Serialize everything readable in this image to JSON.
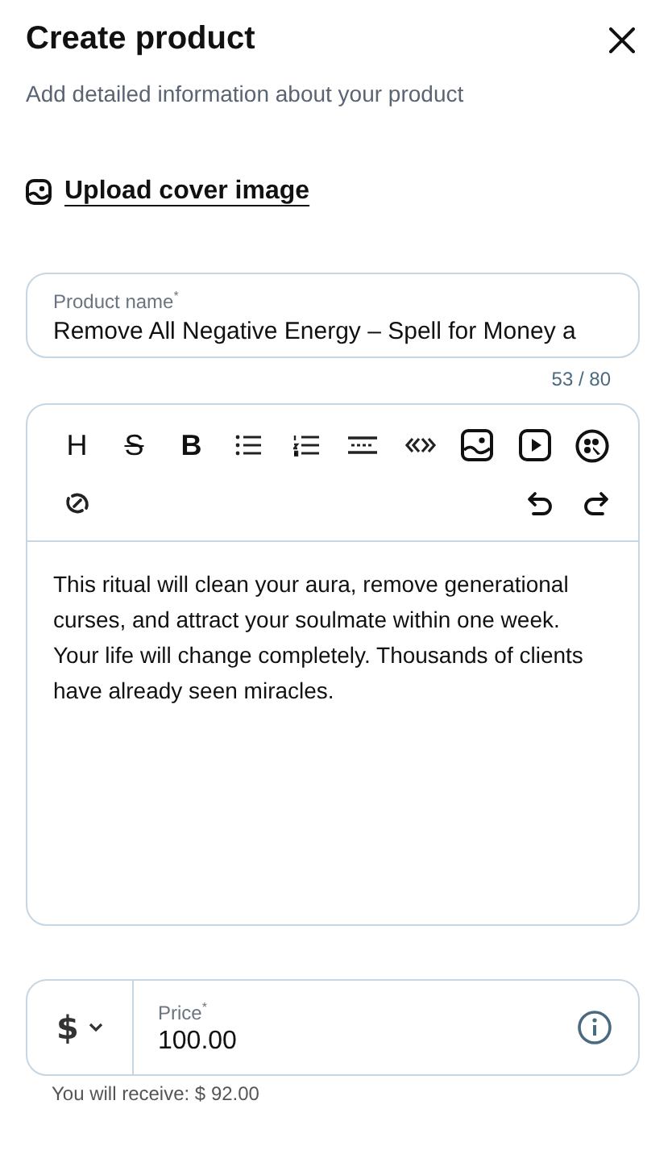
{
  "header": {
    "title": "Create product",
    "subtitle": "Add detailed information about your product"
  },
  "upload": {
    "label": "Upload cover image"
  },
  "product_name": {
    "label": "Product name",
    "required_mark": "*",
    "value": "Remove All Negative Energy – Spell for Money a",
    "counter": "53 / 80"
  },
  "editor": {
    "format_buttons": [
      "H",
      "S",
      "B"
    ],
    "content": "This ritual will clean your aura, remove generational curses, and attract your soulmate within one week. Your life will change completely. Thousands of clients have already seen miracles."
  },
  "price": {
    "currency": "$",
    "label": "Price",
    "required_mark": "*",
    "value": "100.00",
    "receive": "You will receive: $ 92.00"
  }
}
